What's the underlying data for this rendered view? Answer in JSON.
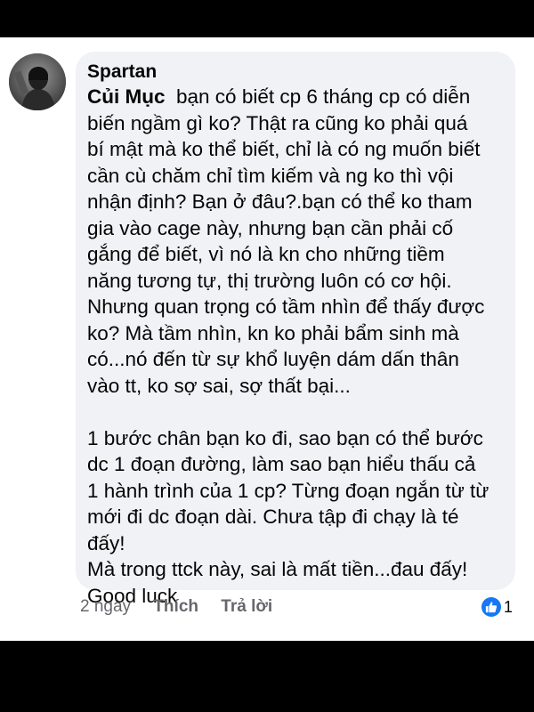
{
  "comment": {
    "author": "Spartan",
    "mention": "Củi Mục",
    "paragraphs": [
      [
        "bạn có biết cp 6 tháng cp có diễn",
        "biến ngầm gì ko? Thật ra cũng ko phải quá",
        "bí mật mà ko thể biết, chỉ là có ng muốn biết",
        "cần cù chăm chỉ tìm kiếm và ng ko thì vội",
        "nhận định? Bạn ở đâu?.bạn có thể ko tham",
        "gia vào cage này, nhưng bạn cần phải cố",
        "gắng để biết, vì nó là kn cho những tiềm",
        "năng tương tự, thị trường luôn có cơ hội.",
        "Nhưng quan trọng có tầm nhìn để thấy được",
        "ko? Mà tầm nhìn, kn ko phải bẩm sinh mà",
        "có...nó đến từ sự khổ luyện dám dấn thân",
        "vào tt, ko sợ sai, sợ thất bại..."
      ],
      [
        "1 bước chân bạn ko đi, sao bạn có thể bước",
        "dc 1 đoạn đường, làm sao bạn hiểu thấu cả",
        "1 hành trình của 1 cp? Từng đoạn ngắn từ từ",
        "mới đi dc đoạn dài. Chưa tập đi chạy là té",
        "đấy!",
        "Mà trong ttck này, sai là mất tiền...đau đấy!",
        "Good luck"
      ]
    ]
  },
  "actions": {
    "time": "2 ngày",
    "like_label": "Thích",
    "reply_label": "Trả lời",
    "reaction_count": "1",
    "reaction_icon": "thumbs-up-icon",
    "reaction_color": "#1877f2"
  }
}
